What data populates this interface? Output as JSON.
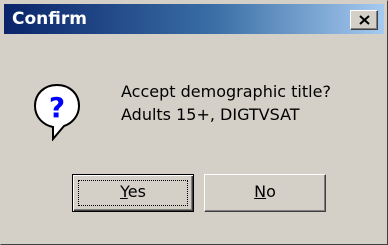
{
  "window": {
    "title": "Confirm",
    "close_glyph": "×"
  },
  "icon": {
    "name": "question-icon",
    "glyph": "?"
  },
  "message": {
    "line1": "Accept demographic title?",
    "line2": "Adults 15+, DIGTVSAT"
  },
  "buttons": {
    "yes": {
      "mnemonic": "Y",
      "rest": "es"
    },
    "no": {
      "mnemonic": "N",
      "rest": "o"
    }
  },
  "colors": {
    "titlebar_start": "#0a246a",
    "titlebar_end": "#a6caf0",
    "face": "#d4d0c8",
    "icon_blue": "#0000ff"
  }
}
